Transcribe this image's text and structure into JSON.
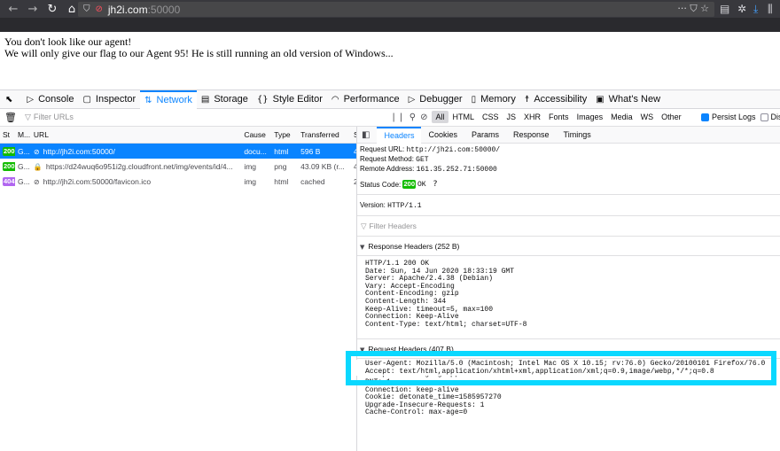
{
  "browser": {
    "url_host": "jh2i.com",
    "url_port": ":50000",
    "back_icon": "back-arrow-icon",
    "forward_icon": "forward-arrow-icon",
    "reload_icon": "reload-icon",
    "home_icon": "home-icon"
  },
  "page": {
    "line1": "You don't look like our agent!",
    "line2": "We will only give our flag to our Agent 95! He is still running an old version of Windows..."
  },
  "devtools": {
    "tabs": {
      "console": "Console",
      "inspector": "Inspector",
      "network": "Network",
      "storage": "Storage",
      "style_editor": "Style Editor",
      "performance": "Performance",
      "debugger": "Debugger",
      "memory": "Memory",
      "accessibility": "Accessibility",
      "whats_new": "What's New"
    },
    "filter_placeholder": "Filter URLs",
    "type_filters": [
      "All",
      "HTML",
      "CSS",
      "JS",
      "XHR",
      "Fonts",
      "Images",
      "Media",
      "WS",
      "Other"
    ],
    "persist_logs": "Persist Logs",
    "disable_cache": "Disa"
  },
  "table": {
    "headers": {
      "status": "St",
      "method": "M...",
      "url": "URL",
      "cause": "Cause",
      "type": "Type",
      "transferred": "Transferred",
      "size": "S"
    },
    "rows": [
      {
        "status": "200",
        "method": "G...",
        "url": "http://jh2i.com:50000/",
        "cause": "docu...",
        "type": "html",
        "transferred": "596 B",
        "size": "4"
      },
      {
        "status": "200",
        "method": "G...",
        "url": "https://d24wuq6o951i2g.cloudfront.net/img/events/id/4...",
        "cause": "img",
        "type": "png",
        "transferred": "43.09 KB (r...",
        "size": "4"
      },
      {
        "status": "404",
        "method": "G...",
        "url": "http://jh2i.com:50000/favicon.ico",
        "cause": "img",
        "type": "html",
        "transferred": "cached",
        "size": "2"
      }
    ]
  },
  "details": {
    "tabs": {
      "headers": "Headers",
      "cookies": "Cookies",
      "params": "Params",
      "response": "Response",
      "timings": "Timings"
    },
    "request_url_label": "Request URL:",
    "request_url": "http://jh2i.com:50000/",
    "request_method_label": "Request Method:",
    "request_method": "GET",
    "remote_address_label": "Remote Address:",
    "remote_address": "161.35.252.71:50000",
    "status_code_label": "Status Code:",
    "status_code": "200",
    "status_text": "OK",
    "version_label": "Version:",
    "version": "HTTP/1.1",
    "filter_headers": "Filter Headers",
    "response_headers_title": "Response Headers (252 B)",
    "response_headers_raw": "HTTP/1.1 200 OK\nDate: Sun, 14 Jun 2020 18:33:19 GMT\nServer: Apache/2.4.38 (Debian)\nVary: Accept-Encoding\nContent-Encoding: gzip\nContent-Length: 344\nKeep-Alive: timeout=5, max=100\nConnection: Keep-Alive\nContent-Type: text/html; charset=UTF-8",
    "request_headers_title": "Request Headers (407 B)",
    "request_headers_raw": "Accept-Encoding: gzip, deflate\nDNT: 1\nConnection: keep-alive\nCookie: detonate_time=1585957270\nUpgrade-Insecure-Requests: 1\nCache-Control: max-age=0",
    "highlighted_headers": "User-Agent: Mozilla/5.0 (Macintosh; Intel Mac OS X 10.15; rv:76.0) Gecko/20100101 Firefox/76.0\nAccept: text/html,application/xhtml+xml,application/xml;q=0.9,image/webp,*/*;q=0.8"
  }
}
